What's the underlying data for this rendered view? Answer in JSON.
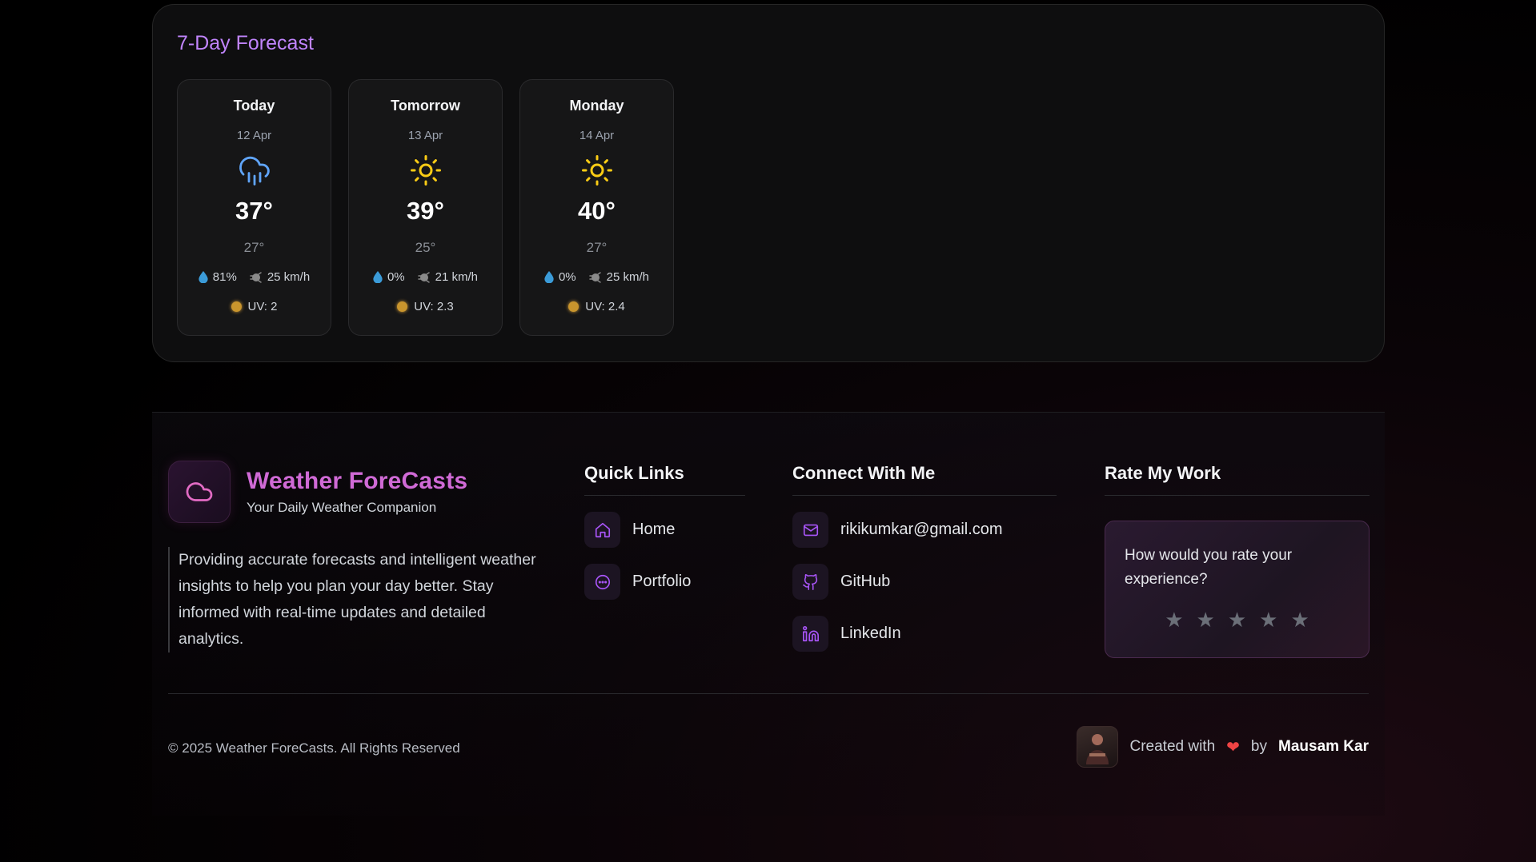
{
  "forecast": {
    "title": "7-Day Forecast",
    "days": [
      {
        "day": "Today",
        "date": "12 Apr",
        "icon": "cloud-rain-icon",
        "high": "37°",
        "low": "27°",
        "humidity": "81%",
        "wind": "25 km/h",
        "uv": "UV: 2"
      },
      {
        "day": "Tomorrow",
        "date": "13 Apr",
        "icon": "sun-icon",
        "high": "39°",
        "low": "25°",
        "humidity": "0%",
        "wind": "21 km/h",
        "uv": "UV: 2.3"
      },
      {
        "day": "Monday",
        "date": "14 Apr",
        "icon": "sun-icon",
        "high": "40°",
        "low": "27°",
        "humidity": "0%",
        "wind": "25 km/h",
        "uv": "UV: 2.4"
      }
    ]
  },
  "footer": {
    "brand_name": "Weather ForeCasts",
    "brand_sub": "Your Daily Weather Companion",
    "description": "Providing accurate forecasts and intelligent weather insights to help you plan your day better. Stay informed with real-time updates and detailed analytics.",
    "quick_links": {
      "title": "Quick Links",
      "items": [
        "Home",
        "Portfolio"
      ]
    },
    "connect": {
      "title": "Connect With Me",
      "items": [
        "rikikumkar@gmail.com",
        "GitHub",
        "LinkedIn"
      ]
    },
    "rate": {
      "title": "Rate My Work",
      "question": "How would you rate your experience?",
      "stars": 5
    },
    "copyright": "© 2025 Weather ForeCasts. All Rights Reserved",
    "credit_prefix": "Created with",
    "credit_by": "by",
    "author": "Mausam Kar"
  },
  "colors": {
    "accent": "#c084fc",
    "brand": "#d06ad6",
    "rain_icon": "#60a5fa",
    "sun_icon": "#facc15",
    "uv_dot": "#c9952d",
    "heart": "#ef4444"
  }
}
